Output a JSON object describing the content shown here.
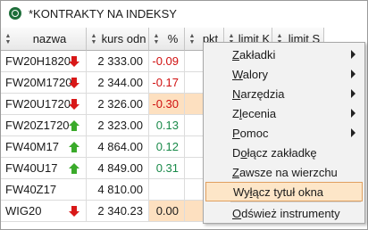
{
  "window": {
    "title": "*KONTRAKTY NA INDEKSY",
    "accent": "#1e6e3a"
  },
  "columns": [
    {
      "key": "nazwa",
      "label": "nazwa"
    },
    {
      "key": "kurs",
      "label": "kurs odn"
    },
    {
      "key": "pct",
      "label": "%"
    },
    {
      "key": "pkt",
      "label": "pkt"
    },
    {
      "key": "limitk",
      "label": "limit K"
    },
    {
      "key": "limits",
      "label": "limit S"
    }
  ],
  "rows": [
    {
      "name": "FW20H1820",
      "arrow": "down",
      "kurs": "2 333.00",
      "pct": "-0.09",
      "trend": "neg",
      "highlight": false
    },
    {
      "name": "FW20M1720",
      "arrow": "down",
      "kurs": "2 344.00",
      "pct": "-0.17",
      "trend": "neg",
      "highlight": false
    },
    {
      "name": "FW20U1720",
      "arrow": "down",
      "kurs": "2 326.00",
      "pct": "-0.30",
      "trend": "neg",
      "highlight": true
    },
    {
      "name": "FW20Z1720",
      "arrow": "up",
      "kurs": "2 323.00",
      "pct": "0.13",
      "trend": "pos",
      "highlight": false
    },
    {
      "name": "FW40M17",
      "arrow": "up",
      "kurs": "4 864.00",
      "pct": "0.12",
      "trend": "pos",
      "highlight": false
    },
    {
      "name": "FW40U17",
      "arrow": "up",
      "kurs": "4 849.00",
      "pct": "0.31",
      "trend": "pos",
      "highlight": false
    },
    {
      "name": "FW40Z17",
      "arrow": "none",
      "kurs": "4 810.00",
      "pct": "",
      "trend": "none",
      "highlight": false
    },
    {
      "name": "WIG20",
      "arrow": "down",
      "kurs": "2 340.23",
      "pct": "0.00",
      "trend": "flat",
      "highlight": true
    }
  ],
  "menu": {
    "items": [
      {
        "pre": "",
        "ul": "Z",
        "post": "akładki",
        "submenu": true
      },
      {
        "pre": "",
        "ul": "W",
        "post": "alory",
        "submenu": true
      },
      {
        "pre": "",
        "ul": "N",
        "post": "arzędzia",
        "submenu": true
      },
      {
        "pre": "Z",
        "ul": "l",
        "post": "ecenia",
        "submenu": true
      },
      {
        "pre": "",
        "ul": "P",
        "post": "omoc",
        "submenu": true
      },
      {
        "pre": "D",
        "ul": "o",
        "post": "łącz zakładkę",
        "submenu": false
      },
      {
        "pre": "",
        "ul": "Z",
        "post": "awsze na wierzchu",
        "submenu": false
      },
      {
        "pre": "Wy",
        "ul": "ł",
        "post": "ącz tytuł okna",
        "submenu": false
      },
      {
        "pre": "",
        "ul": "O",
        "post": "dśwież instrumenty",
        "submenu": false
      }
    ],
    "highlighted_index": 7
  },
  "colors": {
    "negative": "#d01010",
    "positive": "#1a8a4a",
    "row_highlight": "#fde0c0",
    "arrow_down": "#d81818",
    "arrow_up": "#3aaa2a"
  }
}
